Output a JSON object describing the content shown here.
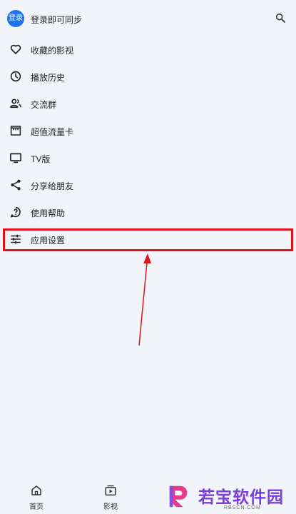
{
  "header": {
    "avatar_text": "登录",
    "login_text": "登录即可同步",
    "search_icon": "search-icon"
  },
  "menu": [
    {
      "label": "收藏的影视",
      "icon": "heart-icon"
    },
    {
      "label": "播放历史",
      "icon": "clock-icon"
    },
    {
      "label": "交流群",
      "icon": "group-icon"
    },
    {
      "label": "超值流量卡",
      "icon": "store-icon"
    },
    {
      "label": "TV版",
      "icon": "tv-icon"
    },
    {
      "label": "分享给朋友",
      "icon": "share-icon"
    },
    {
      "label": "使用帮助",
      "icon": "help-icon"
    },
    {
      "label": "应用设置",
      "icon": "settings-sliders-icon"
    }
  ],
  "bottom_nav": [
    {
      "label": "首页",
      "icon": "home-icon"
    },
    {
      "label": "影视",
      "icon": "video-icon"
    }
  ],
  "watermark": {
    "text": "若宝软件园",
    "subtext": "RBSCN.COM"
  },
  "colors": {
    "background": "#f1f4f9",
    "accent": "#1a73e8",
    "annotation": "#e0131d",
    "watermark": "#7a3fd6"
  }
}
